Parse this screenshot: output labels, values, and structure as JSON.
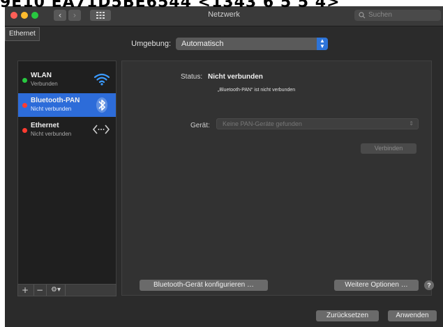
{
  "overlay_text": "9E10 EA71D5BE6544 <1343 6 5 5 4>",
  "window": {
    "title": "Netzwerk",
    "search_placeholder": "Suchen",
    "nav_back": "‹",
    "nav_forward": "›"
  },
  "tooltip": "Ethernet",
  "location": {
    "label": "Umgebung:",
    "value": "Automatisch"
  },
  "services": [
    {
      "name": "WLAN",
      "status": "Verbunden",
      "dot_color": "#28c840",
      "icon": "wifi-icon"
    },
    {
      "name": "Bluetooth-PAN",
      "status": "Nicht verbunden",
      "dot_color": "#ff3b30",
      "icon": "bluetooth-icon"
    },
    {
      "name": "Ethernet",
      "status": "Nicht verbunden",
      "dot_color": "#ff3b30",
      "icon": "ethernet-icon"
    }
  ],
  "sidebar_footer": {
    "add": "+",
    "remove": "−",
    "action": "⚙▾"
  },
  "detail": {
    "status_label": "Status:",
    "status_value": "Nicht verbunden",
    "status_description": "„Bluetooth-PAN“ ist nicht verbunden",
    "device_label": "Gerät:",
    "device_value": "Keine PAN-Geräte gefunden",
    "connect_button": "Verbinden"
  },
  "buttons": {
    "configure": "Bluetooth-Gerät konfigurieren …",
    "advanced": "Weitere Optionen …",
    "help": "?",
    "revert": "Zurücksetzen",
    "apply": "Anwenden"
  },
  "colors": {
    "accent": "#2d6cd9",
    "connected": "#28c840",
    "disconnected": "#ff3b30"
  }
}
